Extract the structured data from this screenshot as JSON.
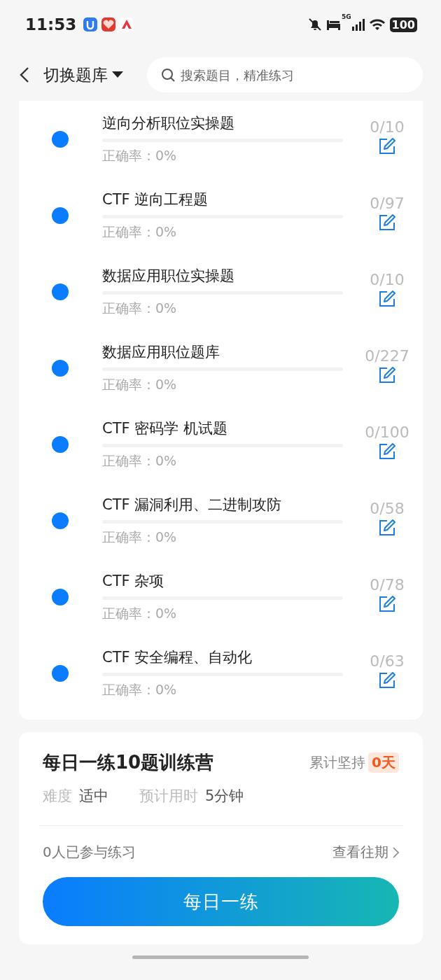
{
  "status_bar": {
    "time": "11:53",
    "battery": "100",
    "network": "5G"
  },
  "header": {
    "title": "切换题库",
    "search": {
      "placeholder": "搜索题目，精准练习"
    }
  },
  "topics": [
    {
      "title": "逆向分析职位实操题",
      "level": 0,
      "accuracy": "正确率：0%",
      "count": "0/10"
    },
    {
      "title": "CTF 逆向工程题",
      "level": 0,
      "accuracy": "正确率：0%",
      "count": "0/97"
    },
    {
      "title": "数据应用职位实操题",
      "level": 0,
      "accuracy": "正确率：0%",
      "count": "0/10"
    },
    {
      "title": "数据应用职位题库",
      "level": 0,
      "accuracy": "正确率：0%",
      "count": "0/227"
    },
    {
      "title": "CTF 密码学 机试题",
      "level": 0,
      "accuracy": "正确率：0%",
      "count": "0/100"
    },
    {
      "title": "CTF 漏洞利用、二进制攻防",
      "level": 0,
      "accuracy": "正确率：0%",
      "count": "0/58"
    },
    {
      "title": "CTF 杂项",
      "level": 0,
      "accuracy": "正确率：0%",
      "count": "0/78"
    },
    {
      "title": "CTF 安全编程、自动化",
      "level": 0,
      "accuracy": "正确率：0%",
      "count": "0/63"
    }
  ],
  "camp": {
    "title": "每日一练10题训练营",
    "streak_label": "累计坚持",
    "streak_value": "0天",
    "difficulty_label": "难度",
    "difficulty": "适中",
    "time_label": "预计用时",
    "time": "5分钟",
    "participants": "0人已参与练习",
    "history_link": "查看往期",
    "button": "每日一练"
  }
}
